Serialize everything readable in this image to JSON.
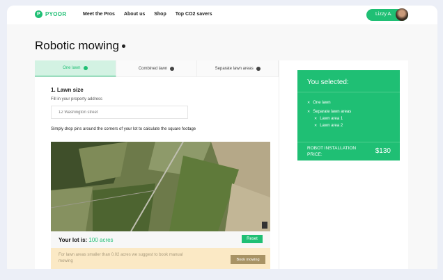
{
  "header": {
    "brand": "PYOOR",
    "brand_mark": "P",
    "nav": [
      "Meet the Pros",
      "About us",
      "Shop",
      "Top CO2 savers"
    ],
    "user": "Lizzy A."
  },
  "page": {
    "title": "Robotic mowing"
  },
  "tabs": [
    {
      "label": "One lawn",
      "active": true
    },
    {
      "label": "Combined lawn",
      "active": false
    },
    {
      "label": "Separate lawn areas",
      "active": false
    }
  ],
  "lawn": {
    "heading": "1. Lawn size",
    "address_label": "Fill in your property address",
    "address_placeholder": "12 Washington street",
    "hint": "Simply drop pins around the corners of your lot to calculate the square footage",
    "lot_label": "Your lot is:",
    "lot_value": "100 acres",
    "reset": "Reset",
    "warning": "For lawn areas smaller than 0.02 acres we suggest to book manual mowing",
    "book": "Book mowing"
  },
  "summary": {
    "title": "You selected:",
    "items": [
      "One lawn",
      "Separate lawn areas"
    ],
    "subitems": [
      "Lawn area 1",
      "Lawn area 2"
    ],
    "price_label": "ROBOT INSTALLATION PRICE:",
    "price": "$130"
  },
  "colors": {
    "accent": "#1fbf74",
    "warning_bg": "#fbe9c5",
    "book_button": "#a89365"
  }
}
